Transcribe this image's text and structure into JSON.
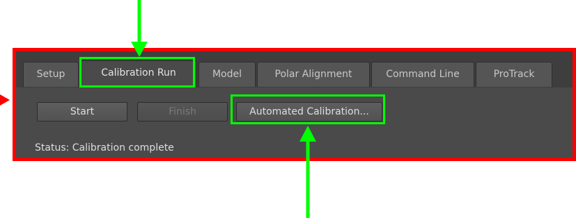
{
  "tabs": [
    {
      "label": "Setup",
      "active": false
    },
    {
      "label": "Calibration Run",
      "active": true
    },
    {
      "label": "Model",
      "active": false
    },
    {
      "label": "Polar Alignment",
      "active": false
    },
    {
      "label": "Command Line",
      "active": false
    },
    {
      "label": "ProTrack",
      "active": false
    }
  ],
  "buttons": {
    "start": {
      "label": "Start",
      "enabled": true
    },
    "finish": {
      "label": "Finish",
      "enabled": false
    },
    "automated": {
      "label": "Automated Calibration...",
      "enabled": true
    }
  },
  "status_text": "Status: Calibration complete",
  "colors": {
    "highlight": "#00ff00",
    "frame": "#ff0000",
    "panel": "#4a4a4a"
  }
}
